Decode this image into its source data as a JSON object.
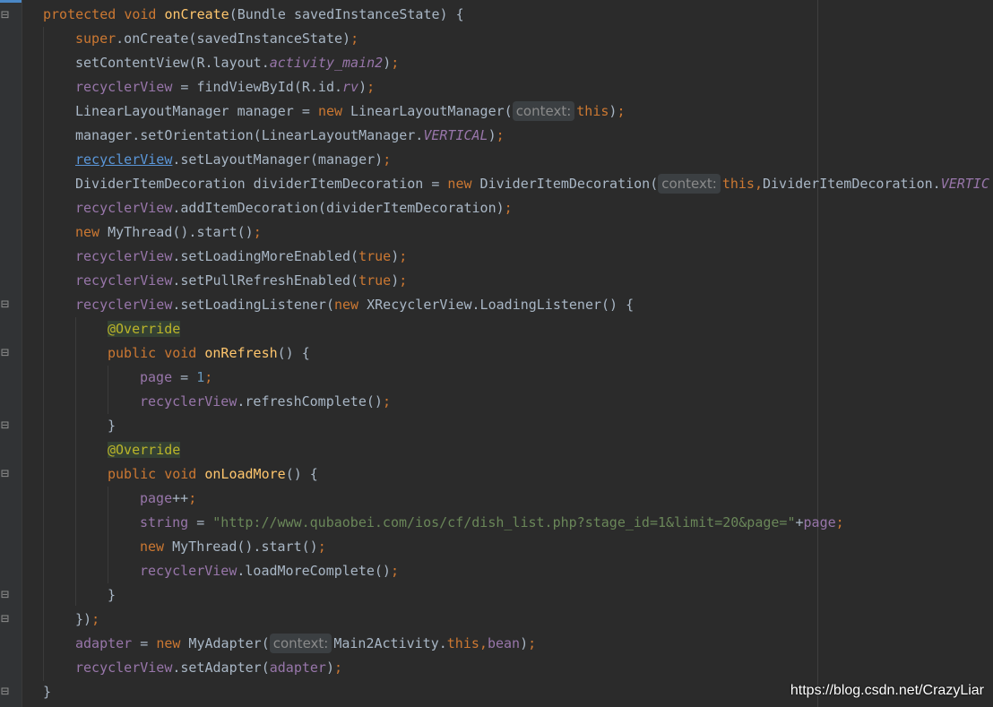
{
  "colors": {
    "background": "#2b2b2b",
    "keyword": "#cc7832",
    "field": "#9876aa",
    "method": "#ffc66d",
    "string": "#6a8759",
    "number": "#6897bb",
    "annotation": "#bbb529",
    "text": "#a9b7c6"
  },
  "code": {
    "l1": {
      "protected": "protected",
      "void": "void",
      "method": "onCreate",
      "rest": "(Bundle savedInstanceState) {"
    },
    "l2": {
      "super": "super",
      "rest": ".onCreate(savedInstanceState)",
      "semi": ";"
    },
    "l3": {
      "pre": "setContentView(R.layout.",
      "const": "activity_main2",
      "post": ")",
      "semi": ";"
    },
    "l4": {
      "field": "recyclerView",
      "pre": " = findViewById(R.id.",
      "const": "rv",
      "post": ")",
      "semi": ";"
    },
    "l5": {
      "pre": "LinearLayoutManager manager = ",
      "new": "new",
      "mid": " LinearLayoutManager(",
      "hint": "context:",
      "this": "this",
      "post": ")",
      "semi": ";"
    },
    "l6": {
      "pre": "manager.setOrientation(LinearLayoutManager.",
      "const": "VERTICAL",
      "post": ")",
      "semi": ";"
    },
    "l7": {
      "field": "recyclerView",
      "rest": ".setLayoutManager(manager)",
      "semi": ";"
    },
    "l8": {
      "pre": "DividerItemDecoration dividerItemDecoration = ",
      "new": "new",
      "mid": " DividerItemDecoration(",
      "hint": "context:",
      "this": "this,",
      "post": "DividerItemDecoration.",
      "const": "VERTIC"
    },
    "l9": {
      "field": "recyclerView",
      "rest": ".addItemDecoration(dividerItemDecoration)",
      "semi": ";"
    },
    "l10": {
      "new": "new",
      "rest": " MyThread().start()",
      "semi": ";"
    },
    "l11": {
      "field": "recyclerView",
      "pre": ".setLoadingMoreEnabled(",
      "bool": "true",
      "post": ")",
      "semi": ";"
    },
    "l12": {
      "field": "recyclerView",
      "pre": ".setPullRefreshEnabled(",
      "bool": "true",
      "post": ")",
      "semi": ";"
    },
    "l13": {
      "field": "recyclerView",
      "pre": ".setLoadingListener(",
      "new": "new",
      "rest": " XRecyclerView.LoadingListener() {"
    },
    "l14": {
      "ann": "@Override"
    },
    "l15": {
      "public": "public",
      "void": "void",
      "method": "onRefresh",
      "rest": "() {"
    },
    "l16": {
      "field": "page",
      "pre": " = ",
      "num": "1",
      "semi": ";"
    },
    "l17": {
      "field": "recyclerView",
      "rest": ".refreshComplete()",
      "semi": ";"
    },
    "l18": {
      "text": "}"
    },
    "l19": {
      "ann": "@Override"
    },
    "l20": {
      "public": "public",
      "void": "void",
      "method": "onLoadMore",
      "rest": "() {"
    },
    "l21": {
      "field": "page",
      "rest": "++",
      "semi": ";"
    },
    "l22": {
      "field": "string",
      "pre": " = ",
      "str": "\"http://www.qubaobei.com/ios/cf/dish_list.php?stage_id=1&limit=20&page=\"",
      "plus": "+",
      "field2": "page",
      "semi": ";"
    },
    "l23": {
      "new": "new",
      "rest": " MyThread().start()",
      "semi": ";"
    },
    "l24": {
      "field": "recyclerView",
      "rest": ".loadMoreComplete()",
      "semi": ";"
    },
    "l25": {
      "text": "}"
    },
    "l26": {
      "text": "})",
      "semi": ";"
    },
    "l27": {
      "field": "adapter",
      "pre": " = ",
      "new": "new",
      "mid": " MyAdapter(",
      "hint": "context:",
      "cls": "Main2Activity.",
      "this": "this,",
      "field2": "bean",
      "post": ")",
      "semi": ";"
    },
    "l28": {
      "field": "recyclerView",
      "pre": ".setAdapter(",
      "field2": "adapter",
      "post": ")",
      "semi": ";"
    },
    "l29": {
      "text": "}"
    }
  },
  "watermark": "https://blog.csdn.net/CrazyLiar"
}
